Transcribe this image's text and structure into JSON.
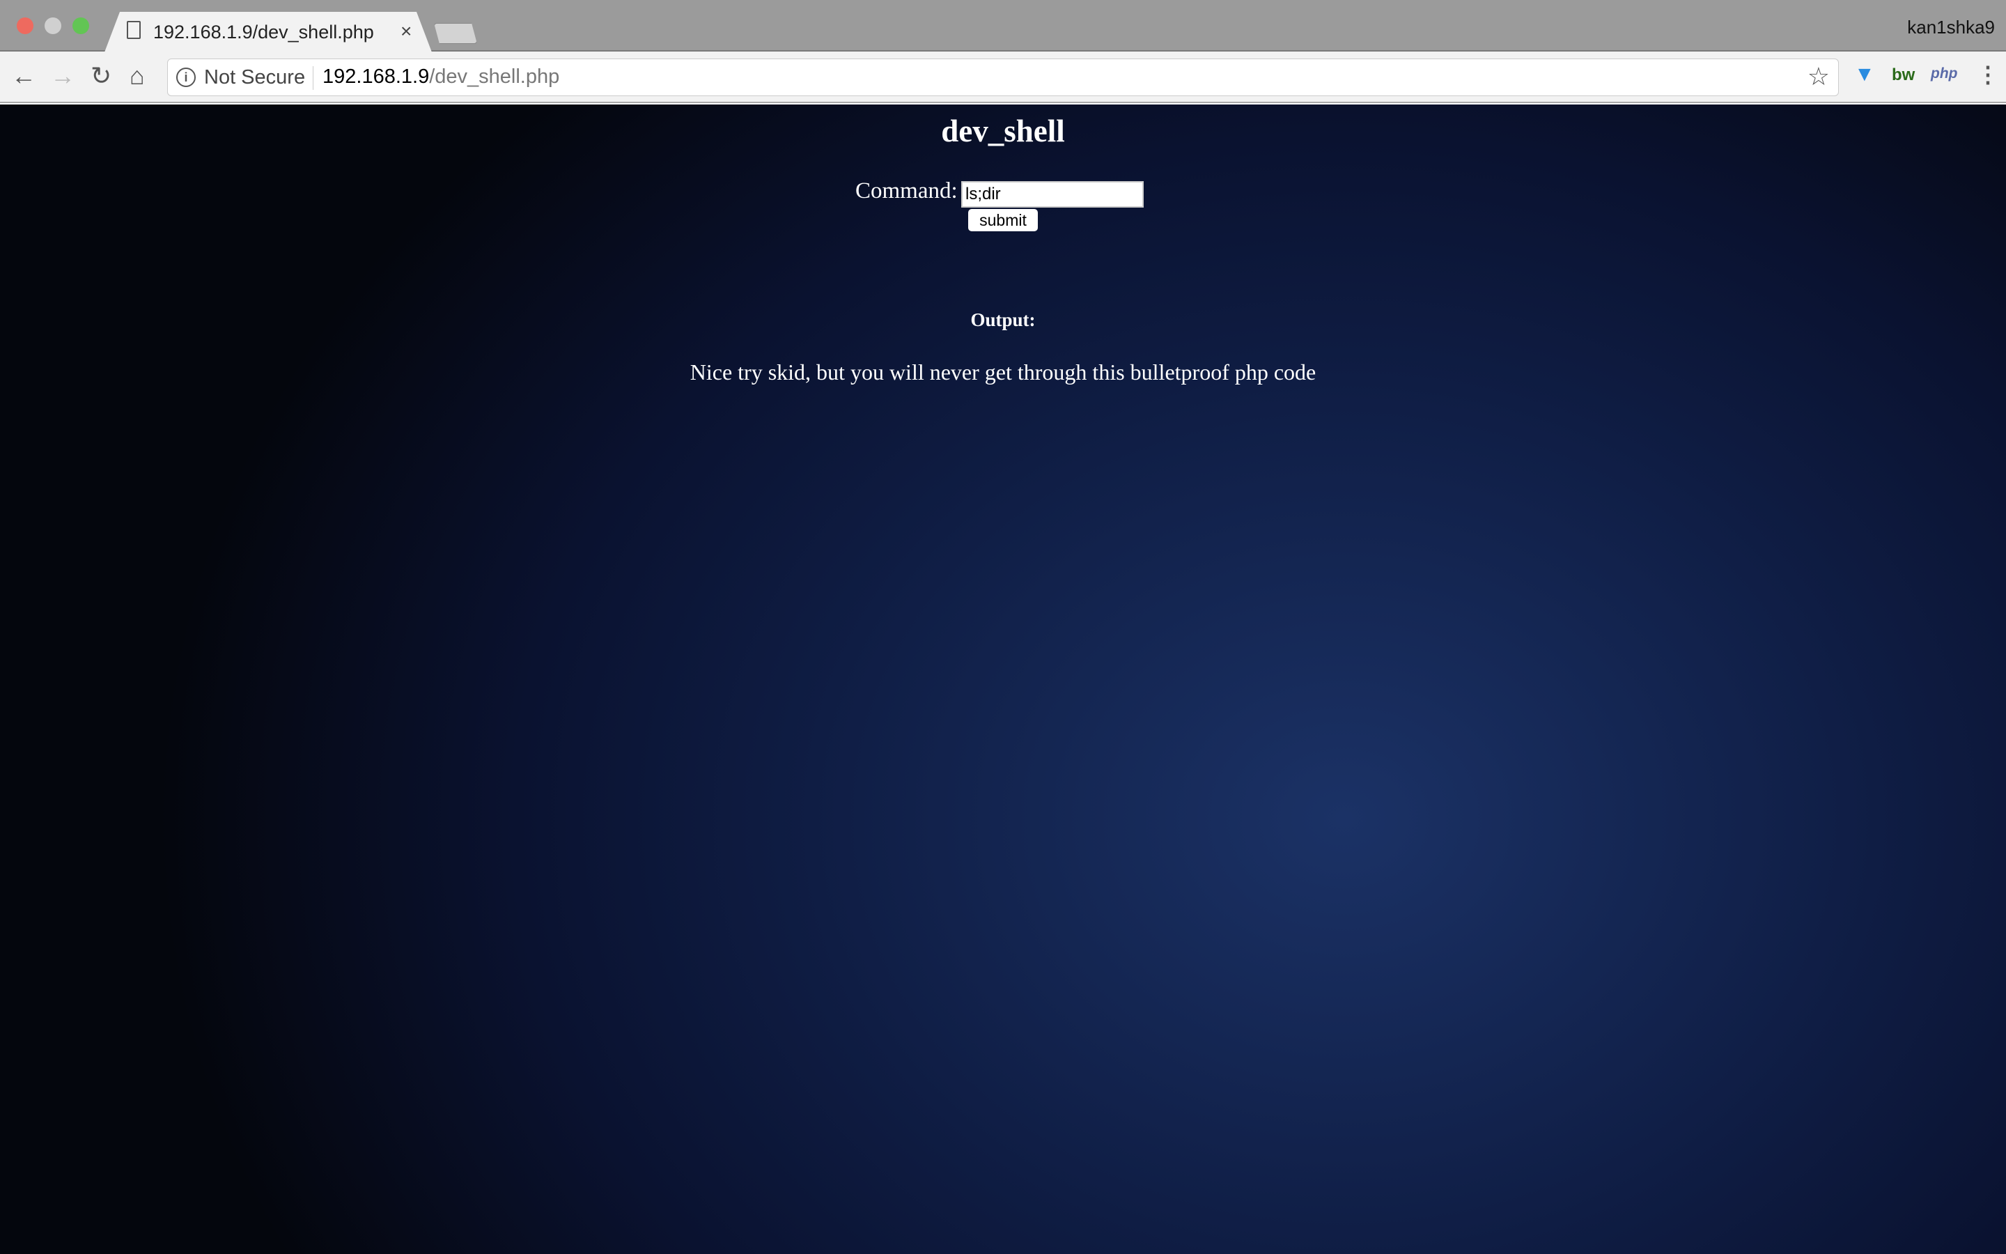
{
  "browser": {
    "tab_title": "192.168.1.9/dev_shell.php",
    "tab_close": "×",
    "user": "kan1shka9",
    "security_label": "Not Secure",
    "url_host": "192.168.1.9",
    "url_path": "/dev_shell.php",
    "extensions": [
      "funnel-extension-icon",
      "bw",
      "php"
    ]
  },
  "page": {
    "title": "dev_shell",
    "command_label": "Command:",
    "command_value": "ls;dir",
    "submit_label": "submit",
    "output_label": "Output:",
    "output_text": "Nice try skid, but you will never get through this bulletproof php code"
  }
}
